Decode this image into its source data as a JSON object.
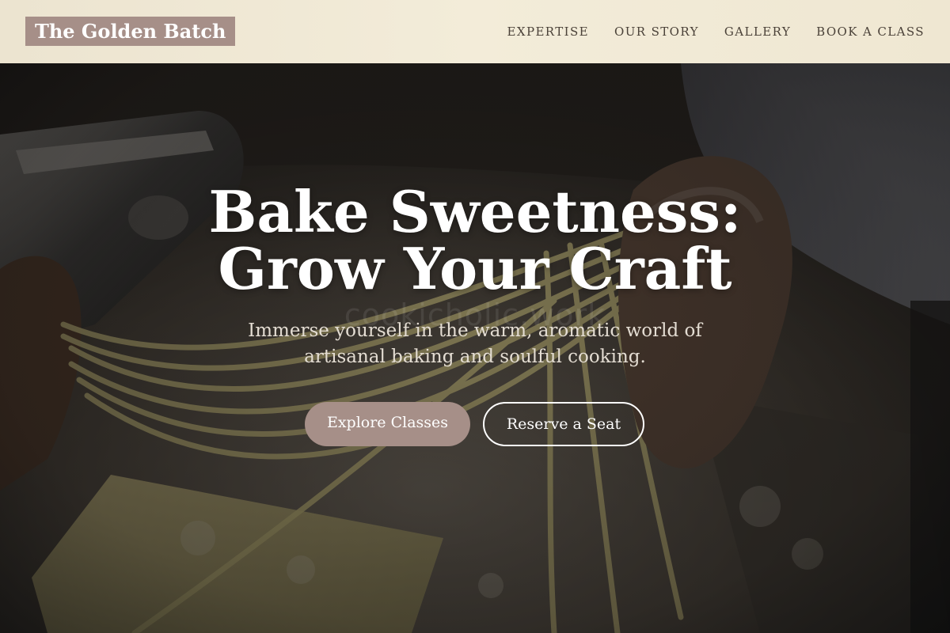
{
  "brand": {
    "name": "The Golden Batch"
  },
  "nav": {
    "items": [
      {
        "label": "EXPERTISE"
      },
      {
        "label": "OUR STORY"
      },
      {
        "label": "GALLERY"
      },
      {
        "label": "BOOK A CLASS"
      }
    ]
  },
  "hero": {
    "title_line1": "Bake Sweetness:",
    "title_line2": "Grow Your Craft",
    "watermark": "cookicholic.work",
    "subtitle": "Immerse yourself in the warm, aromatic world of artisanal baking and soulful cooking.",
    "primary_button": "Explore Classes",
    "secondary_button": "Reserve a Seat"
  },
  "colors": {
    "brand_accent": "#a68f88",
    "header_bg": "#f0e9d6",
    "nav_text": "#4a4138",
    "hero_text": "#ffffff"
  }
}
